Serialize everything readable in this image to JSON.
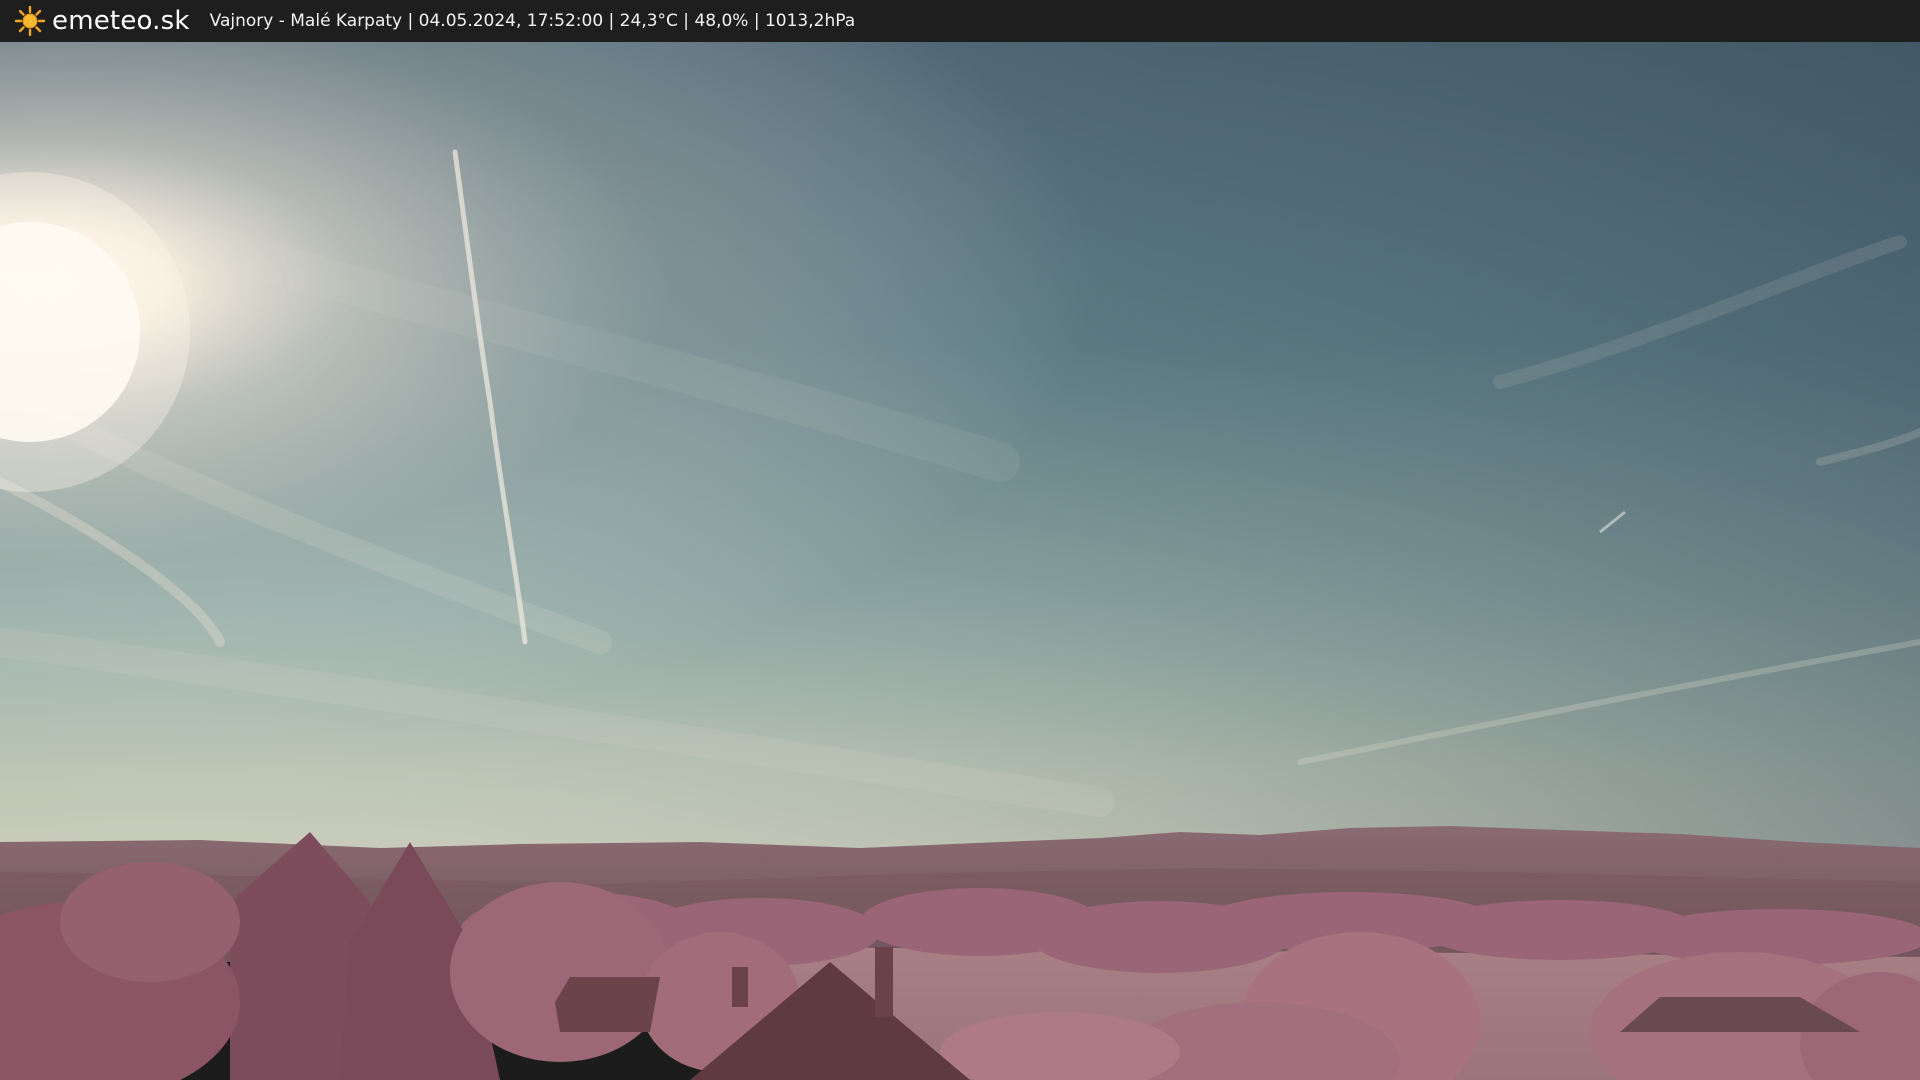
{
  "header": {
    "logo_text": "emeteo.sk",
    "logo_icon": "sun-icon",
    "caption": "Vajnory - Malé Karpaty | 04.05.2024, 17:52:00 | 24,3°C | 48,0% | 1013,2hPa"
  },
  "colors": {
    "bar_background": "#1e1e1e",
    "sun_icon": "#f5a623",
    "sky_top": "#4a6470",
    "sky_horizon": "#c9cdb5",
    "foliage": "#a0677a",
    "hills": "#7d5e66"
  }
}
